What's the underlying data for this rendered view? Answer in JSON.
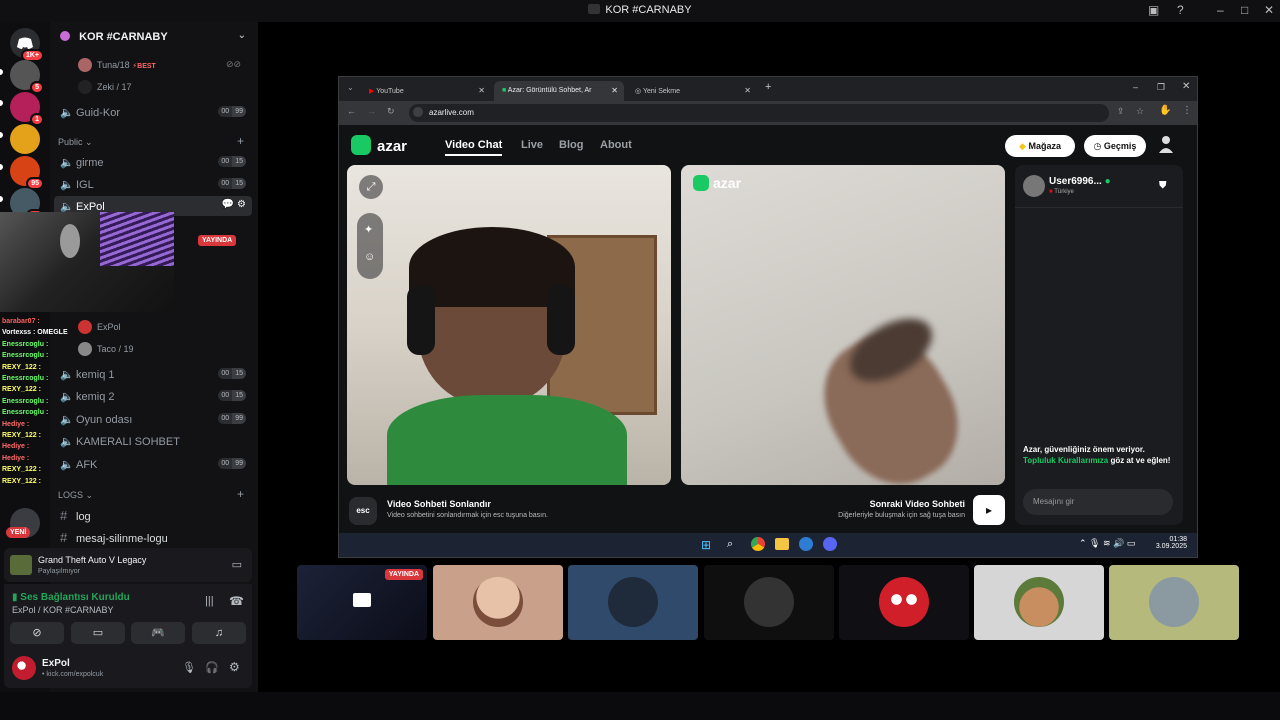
{
  "window": {
    "title": "KOR #CARNABY"
  },
  "rail": {
    "servers": [
      {
        "name": "home",
        "badge": "1K+",
        "color": "#5865f2"
      },
      {
        "name": "server-2",
        "badge": "5",
        "color": "#444"
      },
      {
        "name": "server-3",
        "badge": "1",
        "color": "#c2185b"
      },
      {
        "name": "server-4",
        "badge": "",
        "color": "#f9a825"
      },
      {
        "name": "server-5",
        "badge": "95",
        "color": "#e64a19"
      },
      {
        "name": "server-6",
        "badge": "39",
        "color": "#455a64"
      }
    ]
  },
  "server": {
    "name": "KOR #CARNABY"
  },
  "top_voice": {
    "users": [
      {
        "name": "Tuna/18",
        "tag": "⚡BEST"
      },
      {
        "name": "Zeki / 17"
      }
    ]
  },
  "channels": {
    "guid": {
      "name": "Guid-Kor",
      "count_a": "00",
      "count_b": "99"
    },
    "public_label": "Public",
    "public": [
      {
        "name": "girme",
        "count_a": "00",
        "count_b": "15"
      },
      {
        "name": "IGL",
        "count_a": "00",
        "count_b": "15"
      },
      {
        "name": "ExPol"
      }
    ],
    "live_badge": "YAYINDA",
    "expol_users": [
      {
        "name": "ExPol"
      },
      {
        "name": "Taco / 19"
      }
    ],
    "more": [
      {
        "name": "kemiq 1",
        "count_a": "00",
        "count_b": "15"
      },
      {
        "name": "kemiq 2",
        "count_a": "00",
        "count_b": "15"
      },
      {
        "name": "Oyun odası",
        "count_a": "00",
        "count_b": "99"
      },
      {
        "name": "KAMERALI SOHBET"
      },
      {
        "name": "AFK",
        "count_a": "00",
        "count_b": "99"
      }
    ],
    "logs_label": "LOGS",
    "text": [
      {
        "name": "log"
      },
      {
        "name": "mesaj-silinme-logu"
      }
    ]
  },
  "overlay_chat": [
    {
      "user": "barabar07 :",
      "color": "#ff5f5f"
    },
    {
      "user": "Vortexss : OMEGLE",
      "color": "#ffffff"
    },
    {
      "user": "Enessrcoglu :",
      "color": "#6bff6b"
    },
    {
      "user": "Enessrcoglu :",
      "color": "#6bff6b"
    },
    {
      "user": "REXY_122 :",
      "color": "#ffff6b"
    },
    {
      "user": "Enessrcoglu :",
      "color": "#6bff6b"
    },
    {
      "user": "REXY_122 :",
      "color": "#ffff6b"
    },
    {
      "user": "Enessrcoglu :",
      "color": "#6bff6b"
    },
    {
      "user": "Enessrcoglu :",
      "color": "#6bff6b"
    },
    {
      "user": "Hediye :",
      "color": "#ff6b6b"
    },
    {
      "user": "REXY_122 :",
      "color": "#ffff6b"
    },
    {
      "user": "Hediye :",
      "color": "#ff6b6b"
    },
    {
      "user": "Hediye :",
      "color": "#ff6b6b"
    },
    {
      "user": "REXY_122 :",
      "color": "#ffff6b"
    },
    {
      "user": "REXY_122 :",
      "color": "#ffff6b"
    }
  ],
  "new_badge": "YENİ",
  "activity": {
    "game": "Grand Theft Auto V Legacy",
    "status": "Paylaşılmıyor"
  },
  "voice": {
    "status": "Ses Bağlantısı Kuruldu",
    "location": "ExPol / KOR #CARNABY"
  },
  "user": {
    "name": "ExPol",
    "status": "• kick.com/expolcuk"
  },
  "browser": {
    "tabs": [
      {
        "label": "YouTube"
      },
      {
        "label": "Azar: Görüntülü Sohbet, Ar"
      },
      {
        "label": "Yeni Sekme"
      }
    ],
    "url": "azarlive.com"
  },
  "azar": {
    "logo": "azar",
    "nav": [
      "Video Chat",
      "Live",
      "Blog",
      "About"
    ],
    "store": "Mağaza",
    "history": "Geçmiş",
    "peer": {
      "name": "User6996...",
      "country": "Türkiye"
    },
    "safety_text": "Azar, güvenliğiniz önem veriyor.",
    "safety_link": "Topluluk Kurallarımıza",
    "safety_suffix": "göz at ve eğlen!",
    "message_placeholder": "Mesajını gir",
    "esc_key": "esc",
    "end_title": "Video Sohbeti Sonlandır",
    "end_desc": "Video sohbetini sonlandırmak için esc tuşuna basın.",
    "next_title": "Sonraki Video Sohbeti",
    "next_desc": "Diğerleriyle buluşmak için sağ tuşa basın"
  },
  "taskbar": {
    "time": "01:38",
    "date": "3.09.2025"
  },
  "thumbs": {
    "live_badge": "YAYINDA"
  },
  "colors": {
    "accent": "#5865f2",
    "live": "#da373c",
    "azar_green": "#18c964"
  }
}
